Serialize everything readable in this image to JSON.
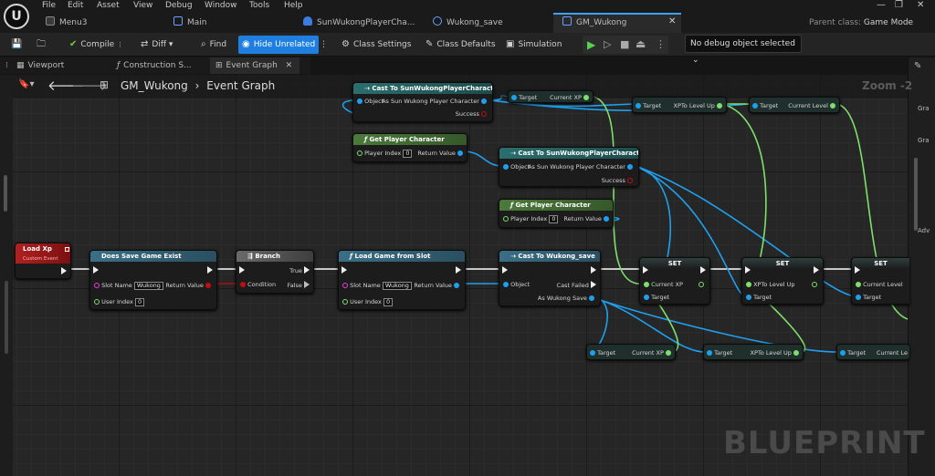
{
  "menu": [
    "File",
    "Edit",
    "Asset",
    "View",
    "Debug",
    "Window",
    "Tools",
    "Help"
  ],
  "tabs": [
    "Menu3",
    "Main",
    "SunWukongPlayerCha...",
    "Wukong_save",
    "GM_Wukong"
  ],
  "parent_class": {
    "label": "Parent class:",
    "value": "Game Mode Base"
  },
  "toolbar": {
    "compile": "Compile",
    "diff": "Diff",
    "find": "Find",
    "hide_unrelated": "Hide Unrelated",
    "class_settings": "Class Settings",
    "class_defaults": "Class Defaults",
    "simulation": "Simulation",
    "debug_object": "No debug object selected"
  },
  "panels": [
    "Viewport",
    "Construction S...",
    "Event Graph"
  ],
  "breadcrumb": {
    "root": "GM_Wukong",
    "sep": "›",
    "graph": "Event Graph"
  },
  "zoom": "Zoom -2",
  "watermark": "BLUEPRINT",
  "right_panel": [
    "Gra",
    "Gra",
    "Adv"
  ],
  "nodes": {
    "load_xp": {
      "title": "Load Xp",
      "subtitle": "Custom Event"
    },
    "does_save": {
      "title": "Does Save Game Exist",
      "slot_name": "Slot Name",
      "slot_value": "Wukong",
      "user_index": "User Index",
      "user_value": "0",
      "return_value": "Return Value"
    },
    "branch": {
      "title": "Branch",
      "condition": "Condition",
      "true": "True",
      "false": "False"
    },
    "load_game": {
      "title": "Load Game from Slot",
      "slot_name": "Slot Name",
      "slot_value": "Wukong",
      "user_index": "User Index",
      "user_value": "0",
      "return_value": "Return Value"
    },
    "cast_wukong_save": {
      "title": "Cast To Wukong_save",
      "object": "Object",
      "cast_failed": "Cast Failed",
      "as": "As Wukong Save"
    },
    "cast_top": {
      "title": "Cast To SunWukongPlayerCharacter",
      "object": "Object",
      "as": "As Sun Wukong Player Character",
      "success": "Success"
    },
    "get_player_1": {
      "title": "Get Player Character",
      "player_index": "Player Index",
      "index_value": "0",
      "return_value": "Return Value"
    },
    "cast_mid": {
      "title": "Cast To SunWukongPlayerCharacter",
      "object": "Object",
      "as": "As Sun Wukong Player Character",
      "success": "Success"
    },
    "get_player_2": {
      "title": "Get Player Character",
      "player_index": "Player Index",
      "index_value": "0",
      "return_value": "Return Value"
    },
    "top_get_1": {
      "target": "Target",
      "value": "Current XP"
    },
    "top_get_2": {
      "target": "Target",
      "value": "XPTo Level Up"
    },
    "top_get_3": {
      "target": "Target",
      "value": "Current Level"
    },
    "set_1": {
      "title": "SET",
      "var": "Current XP",
      "target": "Target"
    },
    "set_2": {
      "title": "SET",
      "var": "XPTo Level Up",
      "target": "Target"
    },
    "set_3": {
      "title": "SET",
      "var": "Current Level",
      "target": "Target"
    },
    "bot_get_1": {
      "target": "Target",
      "value": "Current XP"
    },
    "bot_get_2": {
      "target": "Target",
      "value": "XPTo Level Up"
    },
    "bot_get_3": {
      "target": "Target",
      "value": "Current Le"
    }
  },
  "colors": {
    "accent": "#1f7fe0",
    "exec_wire": "#ffffff",
    "object_wire": "#1fa0ef",
    "float_wire": "#7ee06c"
  }
}
